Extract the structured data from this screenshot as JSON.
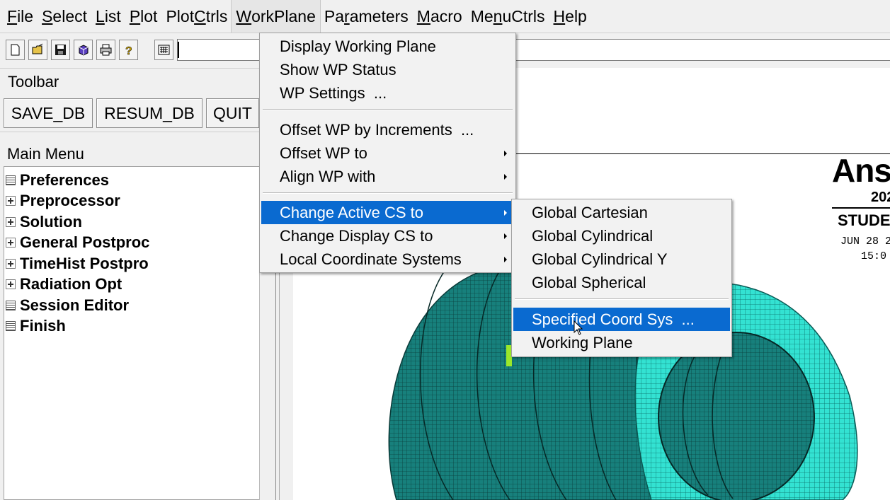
{
  "menubar": {
    "items": [
      {
        "pre": "",
        "u": "F",
        "post": "ile"
      },
      {
        "pre": "",
        "u": "S",
        "post": "elect"
      },
      {
        "pre": "",
        "u": "L",
        "post": "ist"
      },
      {
        "pre": "",
        "u": "P",
        "post": "lot"
      },
      {
        "pre": "Plot",
        "u": "C",
        "post": "trls"
      },
      {
        "pre": "",
        "u": "W",
        "post": "orkPlane"
      },
      {
        "pre": "Pa",
        "u": "r",
        "post": "ameters"
      },
      {
        "pre": "",
        "u": "M",
        "post": "acro"
      },
      {
        "pre": "Me",
        "u": "n",
        "post": "uCtrls"
      },
      {
        "pre": "",
        "u": "H",
        "post": "elp"
      }
    ]
  },
  "iconbar": {
    "icons": [
      "new-file-icon",
      "open-folder-icon",
      "save-icon",
      "cube-icon",
      "print-icon",
      "help-icon",
      "keyboard-icon"
    ],
    "command_value": ""
  },
  "toolbar": {
    "label": "Toolbar",
    "buttons": [
      "SAVE_DB",
      "RESUM_DB",
      "QUIT"
    ]
  },
  "main_menu": {
    "label": "Main Menu",
    "items": [
      {
        "label": "Preferences",
        "icon": "doc"
      },
      {
        "label": "Preprocessor",
        "icon": "plus"
      },
      {
        "label": "Solution",
        "icon": "plus"
      },
      {
        "label": "General Postproc",
        "icon": "plus"
      },
      {
        "label": "TimeHist Postpro",
        "icon": "plus"
      },
      {
        "label": "Radiation Opt",
        "icon": "plus"
      },
      {
        "label": "Session Editor",
        "icon": "doc"
      },
      {
        "label": "Finish",
        "icon": "doc"
      }
    ]
  },
  "workplane_menu": {
    "items": [
      {
        "label": "Display Working Plane",
        "submenu": false
      },
      {
        "label": "Show WP Status",
        "submenu": false
      },
      {
        "label": "WP Settings  ...",
        "submenu": false
      },
      {
        "label": "Offset WP by Increments  ...",
        "submenu": false
      },
      {
        "label": "Offset WP to",
        "submenu": true
      },
      {
        "label": "Align WP with",
        "submenu": true
      },
      {
        "label": "Change Active CS to",
        "submenu": true
      },
      {
        "label": "Change Display CS to",
        "submenu": true
      },
      {
        "label": "Local Coordinate Systems",
        "submenu": true
      }
    ]
  },
  "cs_submenu": {
    "items": [
      {
        "label": "Global Cartesian"
      },
      {
        "label": "Global Cylindrical"
      },
      {
        "label": "Global Cylindrical Y"
      },
      {
        "label": "Global Spherical"
      },
      {
        "label": "Specified Coord Sys  ..."
      },
      {
        "label": "Working Plane"
      }
    ]
  },
  "graphics": {
    "brand": "Ans",
    "year": "202",
    "edition": "STUDE",
    "date": "JUN 28 2",
    "time": "15:0"
  },
  "colors": {
    "highlight": "#0a6ad0",
    "mesh": "#1a8f8a",
    "mesh_end": "#2fe0d0"
  }
}
